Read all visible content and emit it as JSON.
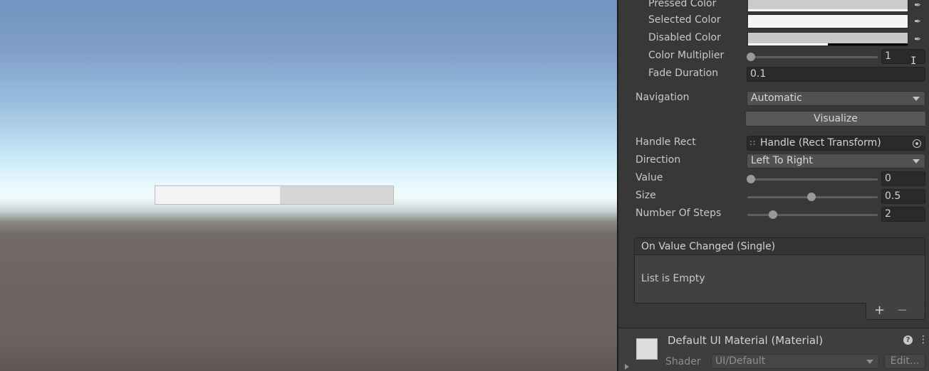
{
  "inspector": {
    "color_rows": [
      {
        "label": "Pressed Color",
        "icon": "eyedropper-icon"
      },
      {
        "label": "Selected Color",
        "icon": "eyedropper-icon"
      },
      {
        "label": "Disabled Color",
        "icon": "eyedropper-icon"
      }
    ],
    "color_multiplier": {
      "label": "Color Multiplier",
      "value": "1",
      "fraction": 0.0
    },
    "fade_duration": {
      "label": "Fade Duration",
      "value": "0.1"
    },
    "navigation": {
      "label": "Navigation",
      "value": "Automatic"
    },
    "visualize_button": "Visualize",
    "handle_rect": {
      "label": "Handle Rect",
      "value": "Handle (Rect Transform)",
      "icon": "rect-transform-icon"
    },
    "direction": {
      "label": "Direction",
      "value": "Left To Right"
    },
    "value": {
      "label": "Value",
      "value": "0",
      "fraction": 0.0
    },
    "size": {
      "label": "Size",
      "value": "0.5",
      "fraction": 0.5
    },
    "number_of_steps": {
      "label": "Number Of Steps",
      "value": "2",
      "fraction": 0.2
    },
    "event": {
      "header": "On Value Changed (Single)",
      "empty_text": "List is Empty",
      "add": "+",
      "remove": "−"
    }
  },
  "material": {
    "title": "Default UI Material (Material)",
    "help": "?",
    "menu": "⋮",
    "shader_label": "Shader",
    "shader_value": "UI/Default",
    "edit_button": "Edit..."
  },
  "scene": {
    "scrollbar_value": 0.0,
    "scrollbar_size": 0.5
  }
}
